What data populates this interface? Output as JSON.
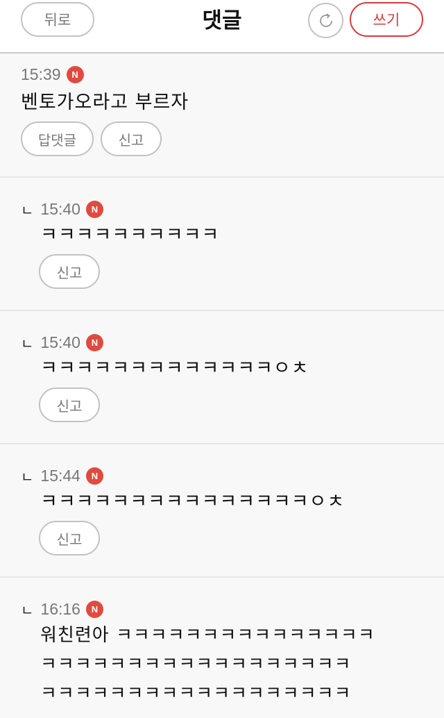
{
  "header": {
    "back_label": "뒤로",
    "title": "댓글",
    "refresh_icon": "refresh-icon",
    "write_label": "쓰기"
  },
  "badge_label": "N",
  "reply_marker": "ㄴ",
  "comments": [
    {
      "time": "15:39",
      "is_new": true,
      "is_reply": false,
      "text": "벤토가오라고 부르자",
      "actions": [
        "답댓글",
        "신고"
      ]
    },
    {
      "time": "15:40",
      "is_new": true,
      "is_reply": true,
      "text": "ㅋㅋㅋㅋㅋㅋㅋㅋㅋㅋ",
      "actions": [
        "신고"
      ]
    },
    {
      "time": "15:40",
      "is_new": true,
      "is_reply": true,
      "text": "ㅋㅋㅋㅋㅋㅋㅋㅋㅋㅋㅋㅋㅋㅇㅊ",
      "actions": [
        "신고"
      ]
    },
    {
      "time": "15:44",
      "is_new": true,
      "is_reply": true,
      "text": "ㅋㅋㅋㅋㅋㅋㅋㅋㅋㅋㅋㅋㅋㅋㅋㅇㅊ",
      "actions": [
        "신고"
      ]
    },
    {
      "time": "16:16",
      "is_new": true,
      "is_reply": true,
      "text": "워친련아 ㅋㅋㅋㅋㅋㅋㅋㅋㅋㅋㅋㅋㅋㅋㅋ\nㅋㅋㅋㅋㅋㅋㅋㅋㅋㅋㅋㅋㅋㅋㅋㅋㅋㅋ\nㅋㅋㅋㅋㅋㅋㅋㅋㅋㅋㅋㅋㅋㅋㅋㅋㅋㅋ",
      "actions": []
    }
  ]
}
